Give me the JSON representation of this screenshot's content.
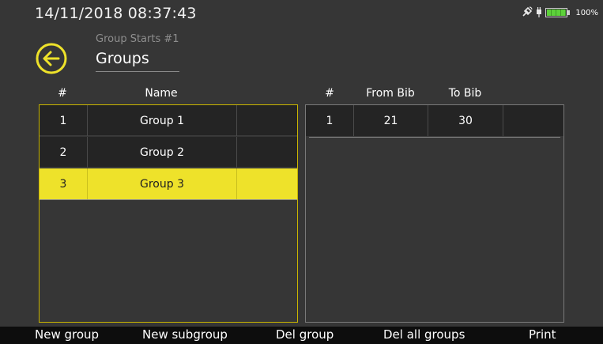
{
  "status_bar": {
    "datetime": "14/11/2018  08:37:43",
    "icons": [
      "satellite-icon",
      "plug-icon",
      "battery-icon"
    ],
    "battery_level": 1.0,
    "battery_percent": "100%"
  },
  "header": {
    "back_icon": "arrow-left-circle-icon",
    "subtitle": "Group Starts #1",
    "title": "Groups"
  },
  "groups_table": {
    "headers": [
      "#",
      "Name"
    ],
    "rows": [
      {
        "num": "1",
        "name": "Group 1",
        "selected": false
      },
      {
        "num": "2",
        "name": "Group 2",
        "selected": false
      },
      {
        "num": "3",
        "name": "Group 3",
        "selected": true
      }
    ]
  },
  "subgroups_table": {
    "headers": [
      "#",
      "From Bib",
      "To Bib"
    ],
    "rows": [
      {
        "num": "1",
        "from": "21",
        "to": "30"
      }
    ]
  },
  "bottom_bar": {
    "new_group": "New group",
    "new_subgroup": "New subgroup",
    "del_group": "Del group",
    "del_all_groups": "Del all groups",
    "print": "Print"
  },
  "colors": {
    "accent": "#eee22a",
    "background": "#363636",
    "row_background": "#242424",
    "bottom_bar": "#0d0d0d"
  }
}
